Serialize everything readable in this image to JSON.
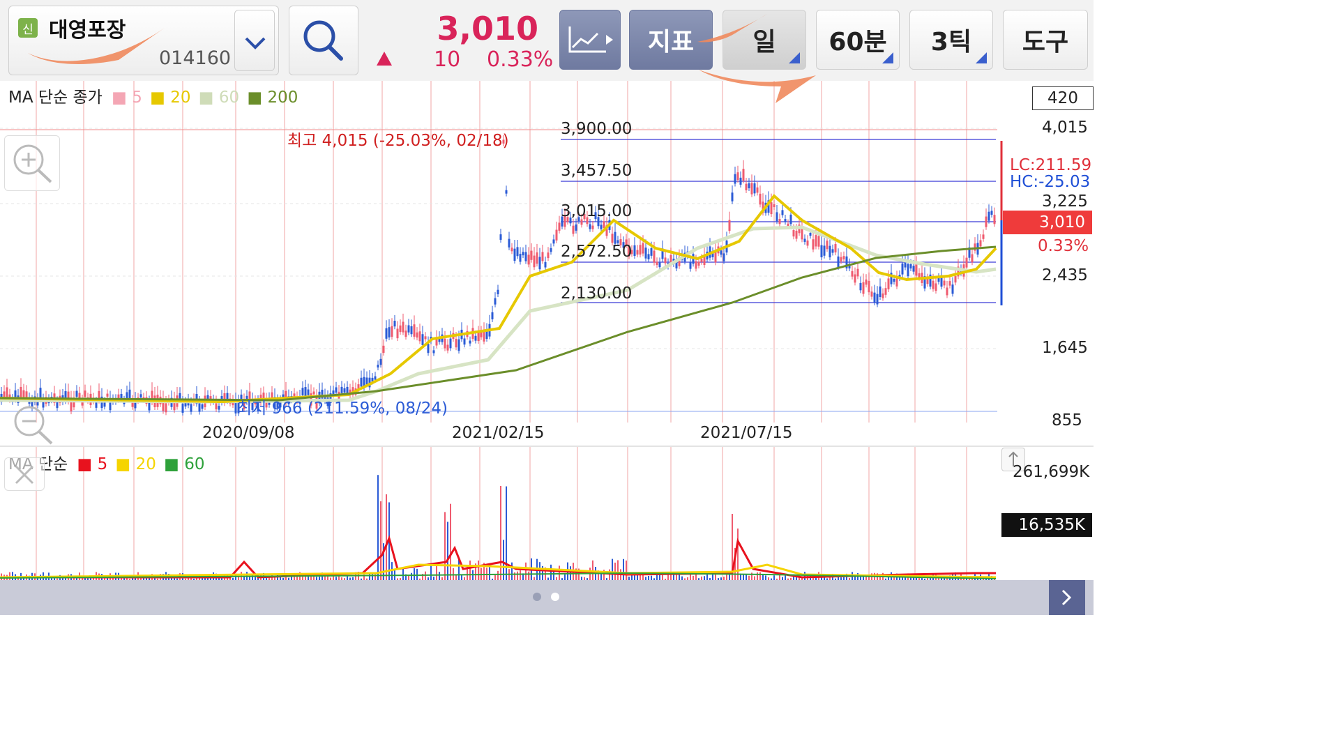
{
  "header": {
    "badge": "신",
    "stock_name": "대영포장",
    "stock_code": "014160",
    "price": "3,010",
    "change": "10",
    "change_pct": "0.33%",
    "buttons": {
      "indicator": "지표",
      "daily": "일",
      "min60": "60분",
      "tick3": "3틱",
      "tools": "도구"
    }
  },
  "price_panel": {
    "ma_title": "MA 단순 종가",
    "ma_legend": [
      {
        "label": "5",
        "color": "#f4a6b4"
      },
      {
        "label": "20",
        "color": "#e6c800"
      },
      {
        "label": "60",
        "color": "#d7e4c4"
      },
      {
        "label": "200",
        "color": "#6b8e2a"
      }
    ],
    "period_box": "420",
    "high_note": "최고 4,015 (-25.03%, 02/18)",
    "low_note": "최저 966 (211.59%, 08/24)",
    "fib_levels": [
      "3,900.00",
      "3,457.50",
      "3,015.00",
      "2,572.50",
      "2,130.00"
    ],
    "y_labels": [
      "4,015",
      "3,225",
      "2,435",
      "1,645",
      "855"
    ],
    "lc": "LC:211.59",
    "hc": "HC:-25.03",
    "current_price_tag": "3,010",
    "current_pct": "0.33%",
    "dates": [
      "2020/09/08",
      "2021/02/15",
      "2021/07/15"
    ]
  },
  "volume_panel": {
    "ma_title": "MA 단순",
    "ma_legend": [
      {
        "label": "5",
        "color": "#e8121e"
      },
      {
        "label": "20",
        "color": "#f5d400"
      },
      {
        "label": "60",
        "color": "#2ea13a"
      }
    ],
    "max_label": "261,699K",
    "current_volume": "16,535K"
  },
  "colors": {
    "up": "#d9245a",
    "down": "#1f4fd6",
    "fib": "#3b3bd6"
  }
}
